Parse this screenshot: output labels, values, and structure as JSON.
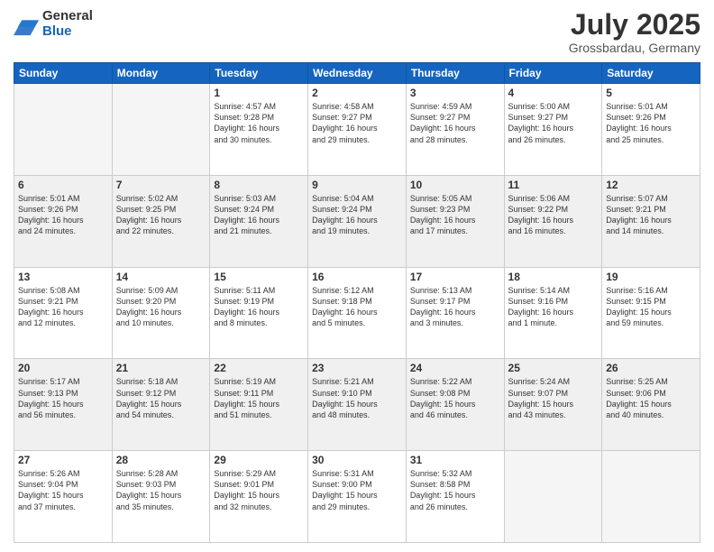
{
  "header": {
    "logo_general": "General",
    "logo_blue": "Blue",
    "month_title": "July 2025",
    "location": "Grossbardau, Germany"
  },
  "weekdays": [
    "Sunday",
    "Monday",
    "Tuesday",
    "Wednesday",
    "Thursday",
    "Friday",
    "Saturday"
  ],
  "weeks": [
    [
      {
        "day": "",
        "info": ""
      },
      {
        "day": "",
        "info": ""
      },
      {
        "day": "1",
        "info": "Sunrise: 4:57 AM\nSunset: 9:28 PM\nDaylight: 16 hours\nand 30 minutes."
      },
      {
        "day": "2",
        "info": "Sunrise: 4:58 AM\nSunset: 9:27 PM\nDaylight: 16 hours\nand 29 minutes."
      },
      {
        "day": "3",
        "info": "Sunrise: 4:59 AM\nSunset: 9:27 PM\nDaylight: 16 hours\nand 28 minutes."
      },
      {
        "day": "4",
        "info": "Sunrise: 5:00 AM\nSunset: 9:27 PM\nDaylight: 16 hours\nand 26 minutes."
      },
      {
        "day": "5",
        "info": "Sunrise: 5:01 AM\nSunset: 9:26 PM\nDaylight: 16 hours\nand 25 minutes."
      }
    ],
    [
      {
        "day": "6",
        "info": "Sunrise: 5:01 AM\nSunset: 9:26 PM\nDaylight: 16 hours\nand 24 minutes."
      },
      {
        "day": "7",
        "info": "Sunrise: 5:02 AM\nSunset: 9:25 PM\nDaylight: 16 hours\nand 22 minutes."
      },
      {
        "day": "8",
        "info": "Sunrise: 5:03 AM\nSunset: 9:24 PM\nDaylight: 16 hours\nand 21 minutes."
      },
      {
        "day": "9",
        "info": "Sunrise: 5:04 AM\nSunset: 9:24 PM\nDaylight: 16 hours\nand 19 minutes."
      },
      {
        "day": "10",
        "info": "Sunrise: 5:05 AM\nSunset: 9:23 PM\nDaylight: 16 hours\nand 17 minutes."
      },
      {
        "day": "11",
        "info": "Sunrise: 5:06 AM\nSunset: 9:22 PM\nDaylight: 16 hours\nand 16 minutes."
      },
      {
        "day": "12",
        "info": "Sunrise: 5:07 AM\nSunset: 9:21 PM\nDaylight: 16 hours\nand 14 minutes."
      }
    ],
    [
      {
        "day": "13",
        "info": "Sunrise: 5:08 AM\nSunset: 9:21 PM\nDaylight: 16 hours\nand 12 minutes."
      },
      {
        "day": "14",
        "info": "Sunrise: 5:09 AM\nSunset: 9:20 PM\nDaylight: 16 hours\nand 10 minutes."
      },
      {
        "day": "15",
        "info": "Sunrise: 5:11 AM\nSunset: 9:19 PM\nDaylight: 16 hours\nand 8 minutes."
      },
      {
        "day": "16",
        "info": "Sunrise: 5:12 AM\nSunset: 9:18 PM\nDaylight: 16 hours\nand 5 minutes."
      },
      {
        "day": "17",
        "info": "Sunrise: 5:13 AM\nSunset: 9:17 PM\nDaylight: 16 hours\nand 3 minutes."
      },
      {
        "day": "18",
        "info": "Sunrise: 5:14 AM\nSunset: 9:16 PM\nDaylight: 16 hours\nand 1 minute."
      },
      {
        "day": "19",
        "info": "Sunrise: 5:16 AM\nSunset: 9:15 PM\nDaylight: 15 hours\nand 59 minutes."
      }
    ],
    [
      {
        "day": "20",
        "info": "Sunrise: 5:17 AM\nSunset: 9:13 PM\nDaylight: 15 hours\nand 56 minutes."
      },
      {
        "day": "21",
        "info": "Sunrise: 5:18 AM\nSunset: 9:12 PM\nDaylight: 15 hours\nand 54 minutes."
      },
      {
        "day": "22",
        "info": "Sunrise: 5:19 AM\nSunset: 9:11 PM\nDaylight: 15 hours\nand 51 minutes."
      },
      {
        "day": "23",
        "info": "Sunrise: 5:21 AM\nSunset: 9:10 PM\nDaylight: 15 hours\nand 48 minutes."
      },
      {
        "day": "24",
        "info": "Sunrise: 5:22 AM\nSunset: 9:08 PM\nDaylight: 15 hours\nand 46 minutes."
      },
      {
        "day": "25",
        "info": "Sunrise: 5:24 AM\nSunset: 9:07 PM\nDaylight: 15 hours\nand 43 minutes."
      },
      {
        "day": "26",
        "info": "Sunrise: 5:25 AM\nSunset: 9:06 PM\nDaylight: 15 hours\nand 40 minutes."
      }
    ],
    [
      {
        "day": "27",
        "info": "Sunrise: 5:26 AM\nSunset: 9:04 PM\nDaylight: 15 hours\nand 37 minutes."
      },
      {
        "day": "28",
        "info": "Sunrise: 5:28 AM\nSunset: 9:03 PM\nDaylight: 15 hours\nand 35 minutes."
      },
      {
        "day": "29",
        "info": "Sunrise: 5:29 AM\nSunset: 9:01 PM\nDaylight: 15 hours\nand 32 minutes."
      },
      {
        "day": "30",
        "info": "Sunrise: 5:31 AM\nSunset: 9:00 PM\nDaylight: 15 hours\nand 29 minutes."
      },
      {
        "day": "31",
        "info": "Sunrise: 5:32 AM\nSunset: 8:58 PM\nDaylight: 15 hours\nand 26 minutes."
      },
      {
        "day": "",
        "info": ""
      },
      {
        "day": "",
        "info": ""
      }
    ]
  ]
}
